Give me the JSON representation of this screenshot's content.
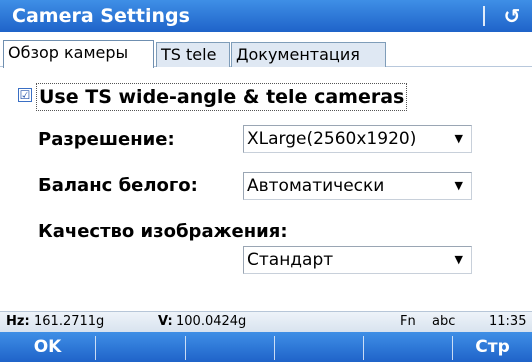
{
  "window": {
    "title": "Camera Settings",
    "back_icon": "undo-arrow-icon",
    "accent": "#2a73d8"
  },
  "tabs": [
    {
      "label": "Обзор камеры",
      "active": true
    },
    {
      "label": "TS tele",
      "active": false
    },
    {
      "label": "Документация",
      "active": false
    }
  ],
  "camera": {
    "use_ts_cameras": {
      "label": "Use TS wide-angle & tele cameras",
      "checked": true,
      "mark": "☑"
    },
    "resolution": {
      "label": "Разрешение:",
      "value": "XLarge(2560x1920)"
    },
    "white_balance": {
      "label": "Баланс белого:",
      "value": "Автоматически"
    },
    "image_quality": {
      "label": "Качество изображения:",
      "value": "Стандарт"
    }
  },
  "status": {
    "hz_label": "Hz:",
    "hz_value": "161.2711g",
    "v_label": "V:",
    "v_value": "100.0424g",
    "fn": "Fn",
    "input_mode": "abc",
    "time": "11:35"
  },
  "softkeys": {
    "ok": "OK",
    "page": "Стр"
  }
}
